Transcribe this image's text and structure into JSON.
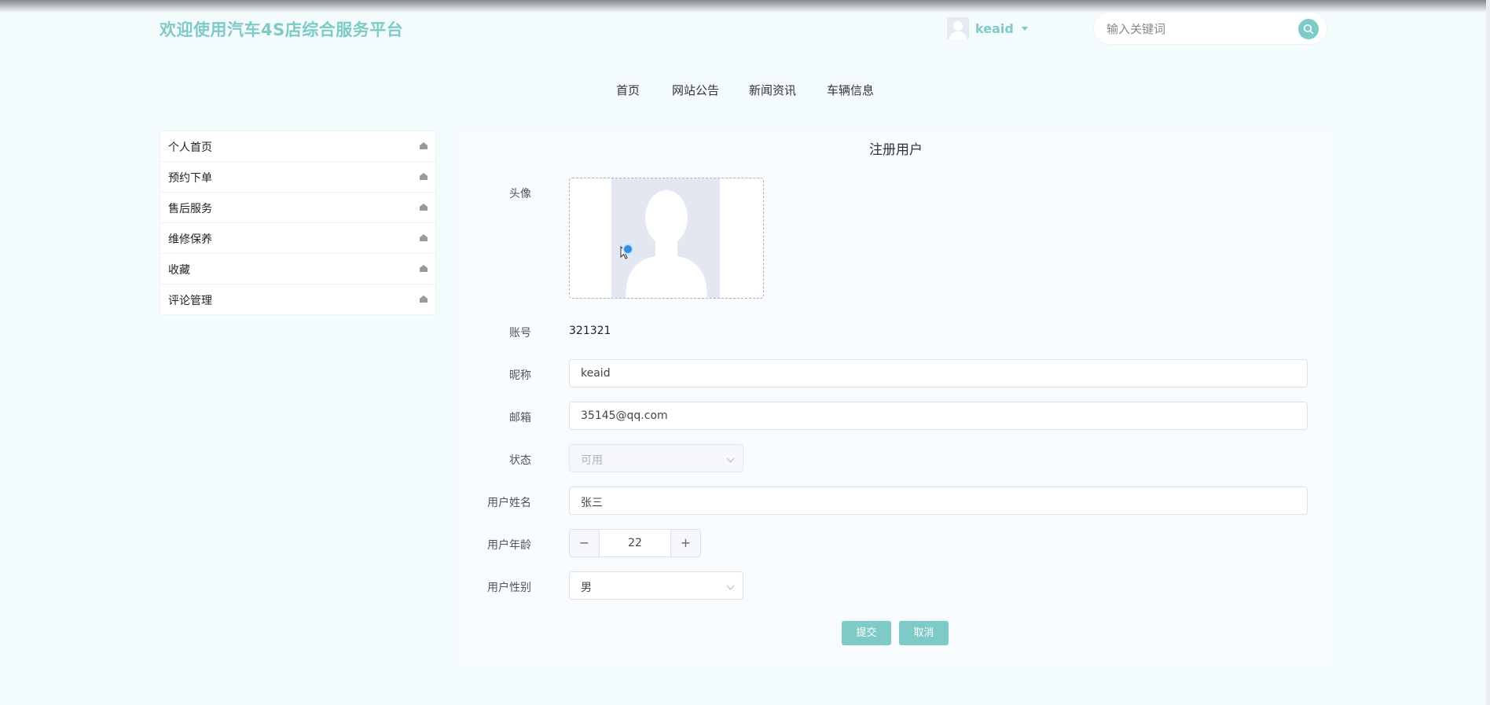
{
  "header": {
    "site_title": "欢迎使用汽车4S店综合服务平台",
    "user_name": "keaid",
    "search_placeholder": "输入关键词"
  },
  "nav": {
    "items": [
      "首页",
      "网站公告",
      "新闻资讯",
      "车辆信息"
    ]
  },
  "sidebar": {
    "items": [
      {
        "label": "个人首页"
      },
      {
        "label": "预约下单"
      },
      {
        "label": "售后服务"
      },
      {
        "label": "维修保养"
      },
      {
        "label": "收藏"
      },
      {
        "label": "评论管理"
      }
    ]
  },
  "form": {
    "title": "注册用户",
    "avatar_label": "头像",
    "account_label": "账号",
    "account_value": "321321",
    "nickname_label": "昵称",
    "nickname_value": "keaid",
    "email_label": "邮箱",
    "email_value": "35145@qq.com",
    "status_label": "状态",
    "status_value": "可用",
    "realname_label": "用户姓名",
    "realname_value": "张三",
    "age_label": "用户年龄",
    "age_value": "22",
    "age_minus": "−",
    "age_plus": "+",
    "gender_label": "用户性别",
    "gender_value": "男",
    "submit_label": "提交",
    "cancel_label": "取消"
  },
  "colors": {
    "accent": "#7ecac7",
    "background": "#f4fbfd"
  }
}
